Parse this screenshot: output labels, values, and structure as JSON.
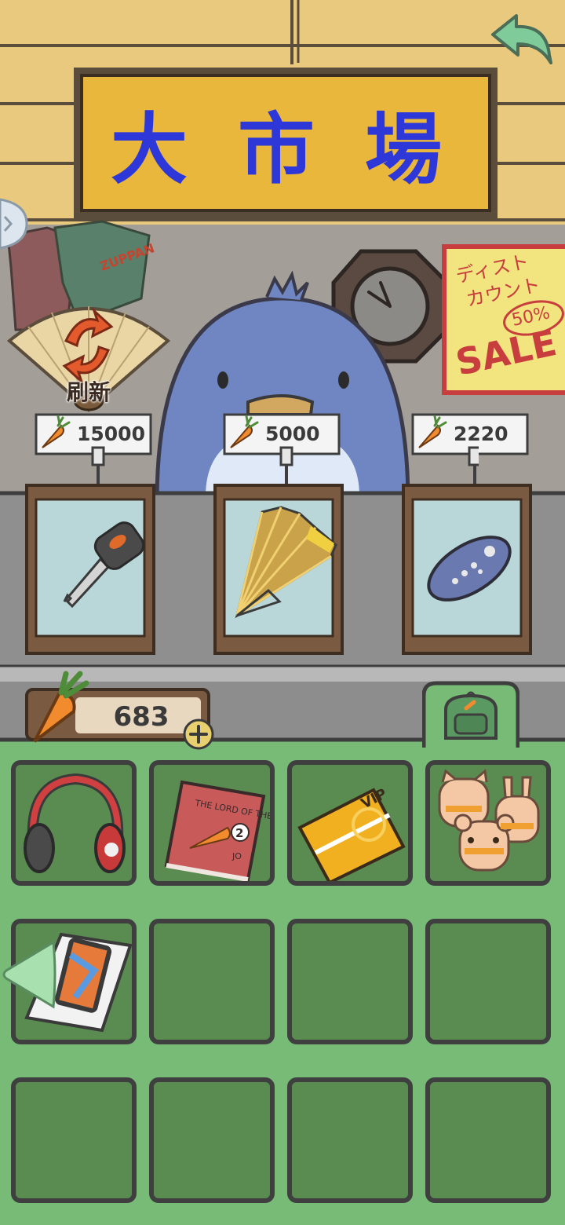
{
  "header": {
    "title": "大市場",
    "back_icon": "back-arrow-icon"
  },
  "refresh": {
    "label": "刷新",
    "icon": "refresh-fan-icon"
  },
  "decor": {
    "poster_line1": "ディスト",
    "poster_line2": "カウント",
    "poster_percent": "50%",
    "poster_sale": "SALE",
    "shirt_text": "ZUPPAN"
  },
  "shop": {
    "items": [
      {
        "price": "15000",
        "icon": "car-key-icon"
      },
      {
        "price": "5000",
        "icon": "folding-fan-icon"
      },
      {
        "price": "2220",
        "icon": "remote-control-icon"
      }
    ]
  },
  "wallet": {
    "carrots": "683",
    "currency_icon": "carrot-icon"
  },
  "inventory": {
    "tab_icon": "backpack-icon",
    "book_title": "THE LORD OF THE CARROTS",
    "book_number": "2",
    "book_author": "JO",
    "vip_text": "VIP",
    "slots": [
      {
        "icon": "headphones-icon"
      },
      {
        "icon": "book-icon"
      },
      {
        "icon": "vip-card-icon"
      },
      {
        "icon": "animal-cookies-icon"
      },
      {
        "icon": "phone-box-icon"
      },
      {
        "icon": ""
      },
      {
        "icon": ""
      },
      {
        "icon": ""
      },
      {
        "icon": ""
      },
      {
        "icon": ""
      },
      {
        "icon": ""
      },
      {
        "icon": ""
      }
    ]
  },
  "colors": {
    "sign_yellow": "#e8b73c",
    "title_blue": "#2e37d8",
    "inventory_green": "#77bb77",
    "cell_green": "#5a8c52",
    "penguin_blue": "#6f86c2"
  }
}
